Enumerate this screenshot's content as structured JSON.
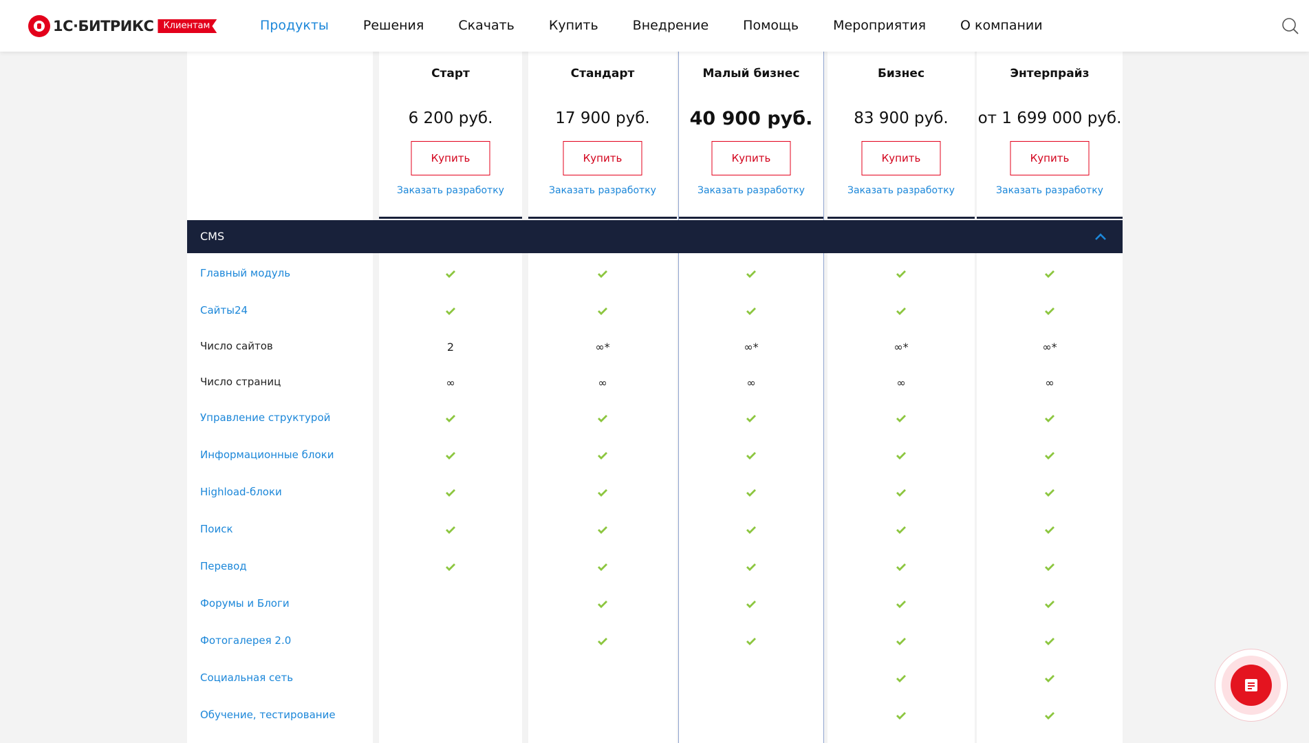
{
  "header": {
    "logo_text": "1С·БИТРИКС",
    "logo_badge": "Клиентам",
    "nav": [
      "Продукты",
      "Решения",
      "Скачать",
      "Купить",
      "Внедрение",
      "Помощь",
      "Мероприятия",
      "О компании"
    ],
    "active_nav": "Продукты"
  },
  "plans": [
    {
      "name": "Старт",
      "price": "6 200 руб.",
      "buy": "Купить",
      "order": "Заказать разработку"
    },
    {
      "name": "Стандарт",
      "price": "17 900 руб.",
      "buy": "Купить",
      "order": "Заказать разработку"
    },
    {
      "name": "Малый бизнес",
      "price": "40 900 руб.",
      "buy": "Купить",
      "order": "Заказать разработку"
    },
    {
      "name": "Бизнес",
      "price": "83 900 руб.",
      "buy": "Купить",
      "order": "Заказать разработку"
    },
    {
      "name": "Энтерпрайз",
      "price": "от 1 699 000 руб.",
      "buy": "Купить",
      "order": "Заказать разработку"
    }
  ],
  "section": {
    "title": "CMS"
  },
  "rows": [
    {
      "label": "Главный модуль",
      "link": true,
      "values": [
        "check",
        "check",
        "check",
        "check",
        "check"
      ]
    },
    {
      "label": "Сайты24",
      "link": true,
      "values": [
        "check",
        "check",
        "check",
        "check",
        "check"
      ]
    },
    {
      "label": "Число сайтов",
      "link": false,
      "values": [
        "2",
        "∞*",
        "∞*",
        "∞*",
        "∞*"
      ]
    },
    {
      "label": "Число страниц",
      "link": false,
      "values": [
        "∞",
        "∞",
        "∞",
        "∞",
        "∞"
      ]
    },
    {
      "label": "Управление структурой",
      "link": true,
      "values": [
        "check",
        "check",
        "check",
        "check",
        "check"
      ]
    },
    {
      "label": "Информационные блоки",
      "link": true,
      "values": [
        "check",
        "check",
        "check",
        "check",
        "check"
      ]
    },
    {
      "label": "Highload-блоки",
      "link": true,
      "values": [
        "check",
        "check",
        "check",
        "check",
        "check"
      ]
    },
    {
      "label": "Поиск",
      "link": true,
      "values": [
        "check",
        "check",
        "check",
        "check",
        "check"
      ]
    },
    {
      "label": "Перевод",
      "link": true,
      "values": [
        "check",
        "check",
        "check",
        "check",
        "check"
      ]
    },
    {
      "label": "Форумы и Блоги",
      "link": true,
      "values": [
        "",
        "check",
        "check",
        "check",
        "check"
      ]
    },
    {
      "label": "Фотогалерея 2.0",
      "link": true,
      "values": [
        "",
        "check",
        "check",
        "check",
        "check"
      ]
    },
    {
      "label": "Социальная сеть",
      "link": true,
      "values": [
        "",
        "",
        "",
        "check",
        "check"
      ]
    },
    {
      "label": "Обучение, тестирование",
      "link": true,
      "values": [
        "",
        "",
        "",
        "check",
        "check"
      ]
    }
  ],
  "colors": {
    "accent": "#1c87d9",
    "brand_red": "#e3001b",
    "check": "#8cc63f",
    "dark_bar": "#18213a"
  },
  "icons": {
    "search": "search-icon",
    "collapse": "chevron-up-icon",
    "chat": "chat-icon",
    "check": "check-icon"
  }
}
